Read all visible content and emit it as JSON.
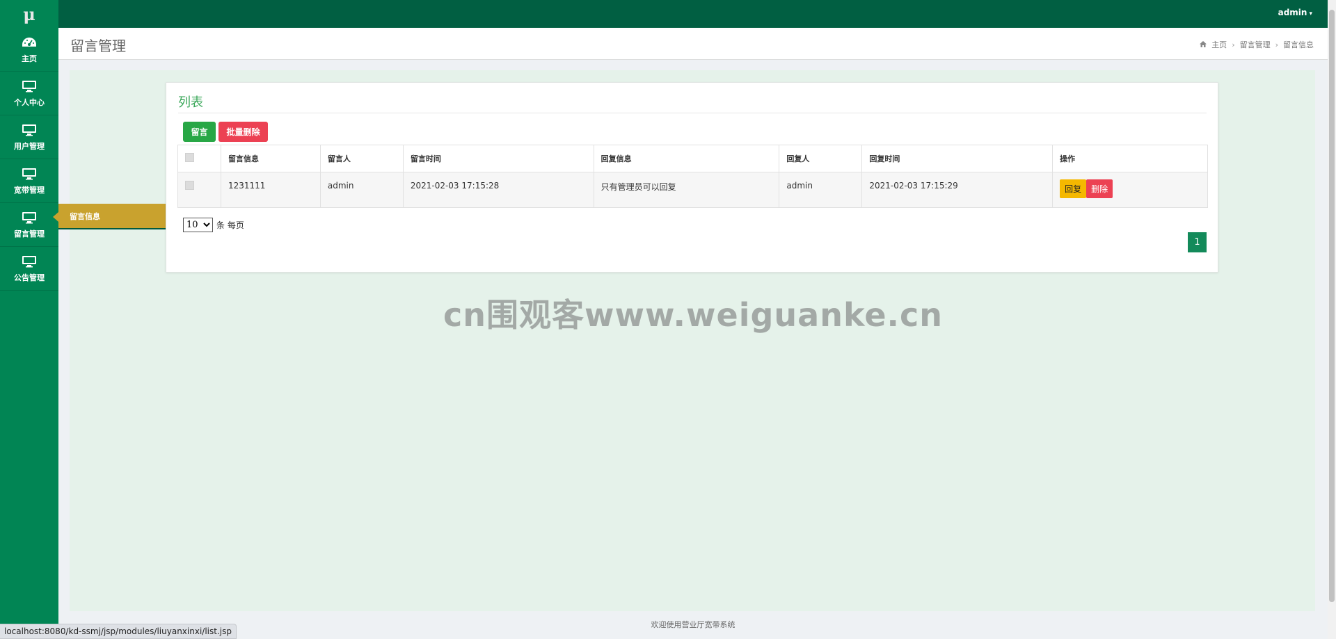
{
  "logo": "μ",
  "user": {
    "name": "admin",
    "caret": "▾"
  },
  "sidebar": {
    "items": [
      {
        "label": "主页",
        "icon": "dashboard-icon"
      },
      {
        "label": "个人中心",
        "icon": "monitor-icon"
      },
      {
        "label": "用户管理",
        "icon": "monitor-icon"
      },
      {
        "label": "宽带管理",
        "icon": "monitor-icon"
      },
      {
        "label": "留言管理",
        "icon": "monitor-icon"
      },
      {
        "label": "公告管理",
        "icon": "monitor-icon"
      }
    ],
    "submenu_label": "留言信息"
  },
  "header": {
    "title": "留言管理",
    "breadcrumb": [
      "主页",
      "留言管理",
      "留言信息"
    ]
  },
  "card": {
    "title": "列表",
    "add_label": "留言",
    "bulk_delete_label": "批量删除"
  },
  "table": {
    "columns": [
      "留言信息",
      "留言人",
      "留言时间",
      "回复信息",
      "回复人",
      "回复时间",
      "操作"
    ],
    "rows": [
      {
        "message": "1231111",
        "author": "admin",
        "time": "2021-02-03 17:15:28",
        "reply": "只有管理员可以回复",
        "replier": "admin",
        "reply_time": "2021-02-03 17:15:29",
        "reply_btn": "回复",
        "delete_btn": "删除"
      }
    ]
  },
  "pagination": {
    "page_size": "10",
    "page_size_suffix": "条 每页",
    "current_page": "1"
  },
  "watermark": "cn围观客www.weiguanke.cn",
  "footer": "欢迎使用营业厅宽带系统",
  "status_url": "localhost:8080/kd-ssmj/jsp/modules/liuyanxinxi/list.jsp",
  "colors": {
    "sidebar": "#018554",
    "topbar": "#015f42",
    "submenu": "#c9a22e",
    "accent_green": "#3aa759",
    "danger": "#ec4153",
    "warning": "#f5b800"
  }
}
